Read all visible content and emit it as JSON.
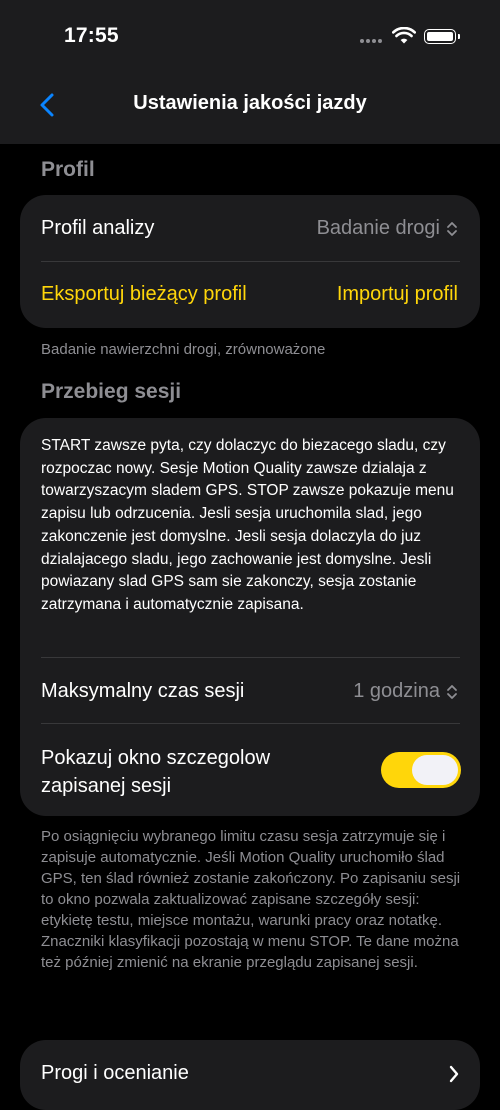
{
  "status": {
    "time": "17:55"
  },
  "nav": {
    "title": "Ustawienia jakości jazdy"
  },
  "profile": {
    "header": "Profil",
    "analysis_label": "Profil analizy",
    "analysis_value": "Badanie drogi",
    "export_label": "Eksportuj bieżący profil",
    "import_label": "Importuj profil",
    "footer": "Badanie nawierzchni drogi, zrównoważone"
  },
  "session": {
    "header": "Przebieg sesji",
    "description": "START zawsze pyta, czy dolaczyc do biezacego sladu, czy rozpoczac nowy. Sesje Motion Quality zawsze dzialaja z towarzyszacym sladem GPS. STOP zawsze pokazuje menu zapisu lub odrzucenia. Jesli sesja uruchomila slad, jego zakonczenie jest domyslne. Jesli sesja dolaczyla do juz dzialajacego sladu, jego zachowanie jest domyslne. Jesli powiazany slad GPS sam sie zakonczy, sesja zostanie zatrzymana i automatycznie zapisana.",
    "max_time_label": "Maksymalny czas sesji",
    "max_time_value": "1 godzina",
    "show_details_label_line1": "Pokazuj okno szczegolow",
    "show_details_label_line2": "zapisanej sesji",
    "show_details_on": true,
    "footer": "Po osiągnięciu wybranego limitu czasu sesja zatrzymuje się i zapisuje automatycznie. Jeśli Motion Quality uruchomiło ślad GPS, ten ślad również zostanie zakończony. Po zapisaniu sesji to okno pozwala zaktualizować zapisane szczegóły sesji: etykietę testu, miejsce montażu, warunki pracy oraz notatkę. Znaczniki klasyfikacji pozostają w menu STOP. Te dane można też później zmienić na ekranie przeglądu zapisanej sesji."
  },
  "thresholds": {
    "label": "Progi i ocenianie"
  },
  "colors": {
    "accent": "#ffd60a",
    "link": "#0a84ff",
    "card": "#1c1c1e"
  }
}
